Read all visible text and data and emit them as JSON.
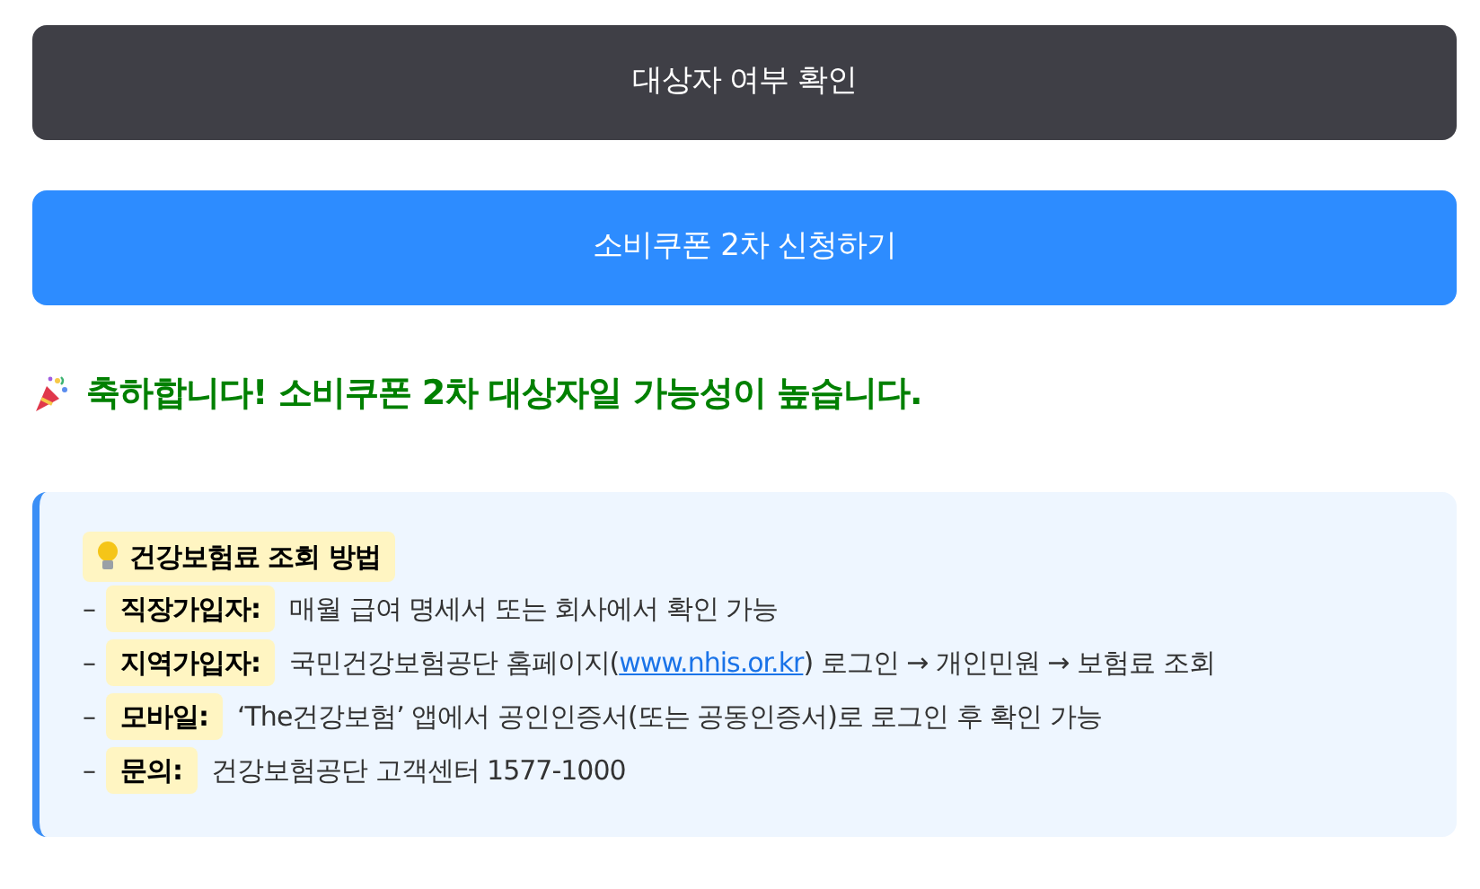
{
  "buttons": [
    {
      "label": "대상자 여부 확인",
      "kind": "dark"
    },
    {
      "label": "소비쿠폰 2차 신청하기",
      "kind": "primary"
    }
  ],
  "result": {
    "message": "축하합니다! 소비쿠폰 2차 대상자일 가능성이 높습니다."
  },
  "info": {
    "title": "건강보험료 조회 방법",
    "items": [
      {
        "marker": "–",
        "label": "직장가입자:",
        "text": "매월 급여 명세서 또는 회사에서 확인 가능"
      },
      {
        "marker": "–",
        "label": "지역가입자:",
        "text": "국민건강보험공단 홈페이지(",
        "link": "www.nhis.or.kr",
        "text_after": ") 로그인 → 개인민원 → 보험료 조회"
      },
      {
        "marker": "–",
        "label": "모바일:",
        "text": "‘The건강보험’ 앱에서 공인인증서(또는 공동인증서)로 로그인 후 확인 가능"
      },
      {
        "marker": "–",
        "label": "문의:",
        "text": "건강보험공단 고객센터 1577-1000"
      }
    ]
  }
}
